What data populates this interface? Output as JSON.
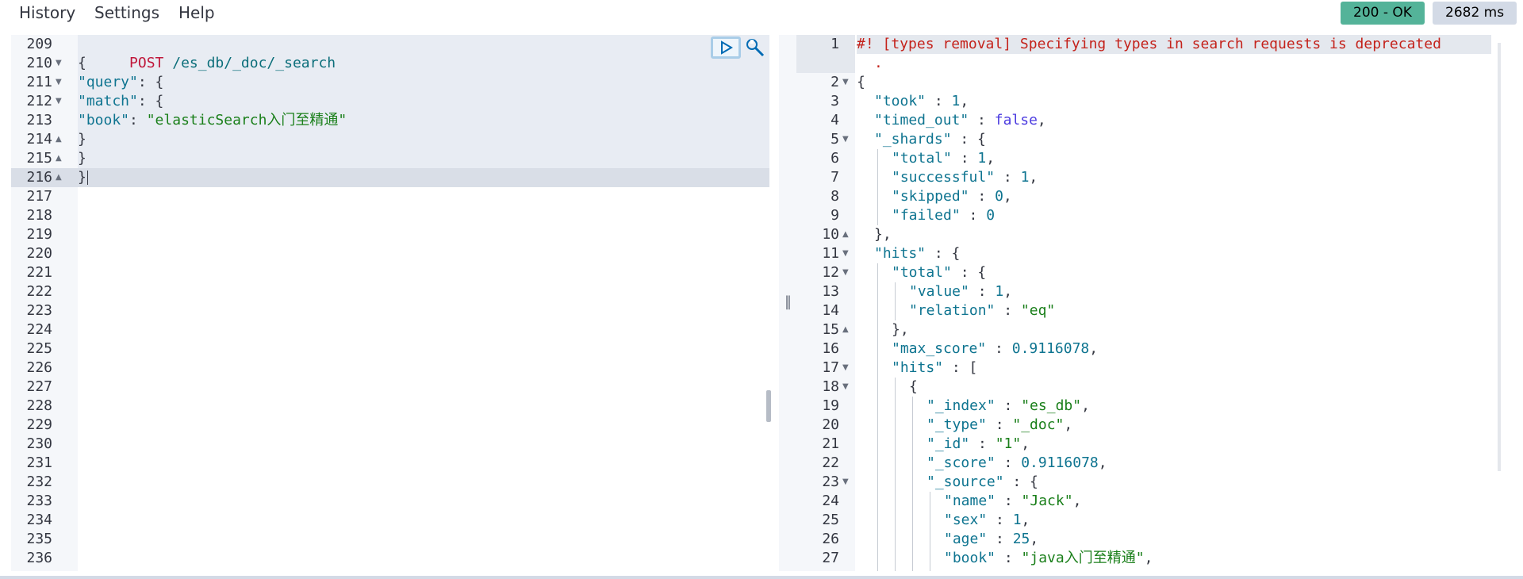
{
  "menu": {
    "history": "History",
    "settings": "Settings",
    "help": "Help"
  },
  "status": {
    "code": "200 - OK",
    "time": "2682 ms",
    "ok_color": "#54b399"
  },
  "request": {
    "line_numbers": [
      "209",
      "210",
      "211",
      "212",
      "213",
      "214",
      "215",
      "216",
      "217",
      "218",
      "219",
      "220",
      "221",
      "222",
      "223",
      "224",
      "225",
      "226",
      "227",
      "228",
      "229",
      "230",
      "231",
      "232",
      "233",
      "234",
      "235",
      "236"
    ],
    "method": "POST",
    "url": " /es_db/_doc/_search",
    "l210": "{",
    "l211_key": "\"query\"",
    "l211_rest": ": {",
    "l212_key": "\"match\"",
    "l212_rest": ": {",
    "l213_key": "\"book\"",
    "l213_colon": ": ",
    "l213_val": "\"elasticSearch入门至精通\"",
    "l214": "}",
    "l215": "}",
    "l216": "}",
    "run_icon": "play-icon",
    "wrench_icon": "wrench-icon"
  },
  "response": {
    "line_numbers": [
      "1",
      "2",
      "3",
      "4",
      "5",
      "6",
      "7",
      "8",
      "9",
      "10",
      "11",
      "12",
      "13",
      "14",
      "15",
      "16",
      "17",
      "18",
      "19",
      "20",
      "21",
      "22",
      "23",
      "24",
      "25",
      "26",
      "27"
    ],
    "warning": "#! [types removal] Specifying types in search requests is deprecated",
    "warning_wrap": ".",
    "lines": {
      "l2": "{",
      "took_k": "\"took\"",
      "took_v": "1",
      "timed_out_k": "\"timed_out\"",
      "timed_out_v": "false",
      "shards_k": "\"_shards\"",
      "total_k": "\"total\"",
      "total_v": "1",
      "successful_k": "\"successful\"",
      "successful_v": "1",
      "skipped_k": "\"skipped\"",
      "skipped_v": "0",
      "failed_k": "\"failed\"",
      "failed_v": "0",
      "l10": "},",
      "hits_k": "\"hits\"",
      "htotal_k": "\"total\"",
      "value_k": "\"value\"",
      "value_v": "1",
      "relation_k": "\"relation\"",
      "relation_v": "\"eq\"",
      "l15": "},",
      "max_score_k": "\"max_score\"",
      "max_score_v": "0.9116078",
      "hits2_k": "\"hits\"",
      "l18": "{",
      "index_k": "\"_index\"",
      "index_v": "\"es_db\"",
      "type_k": "\"_type\"",
      "type_v": "\"_doc\"",
      "id_k": "\"_id\"",
      "id_v": "\"1\"",
      "score_k": "\"_score\"",
      "score_v": "0.9116078",
      "source_k": "\"_source\"",
      "name_k": "\"name\"",
      "name_v": "\"Jack\"",
      "sex_k": "\"sex\"",
      "sex_v": "1",
      "age_k": "\"age\"",
      "age_v": "25",
      "book_k": "\"book\"",
      "book_v": "\"java入门至精通\""
    }
  }
}
